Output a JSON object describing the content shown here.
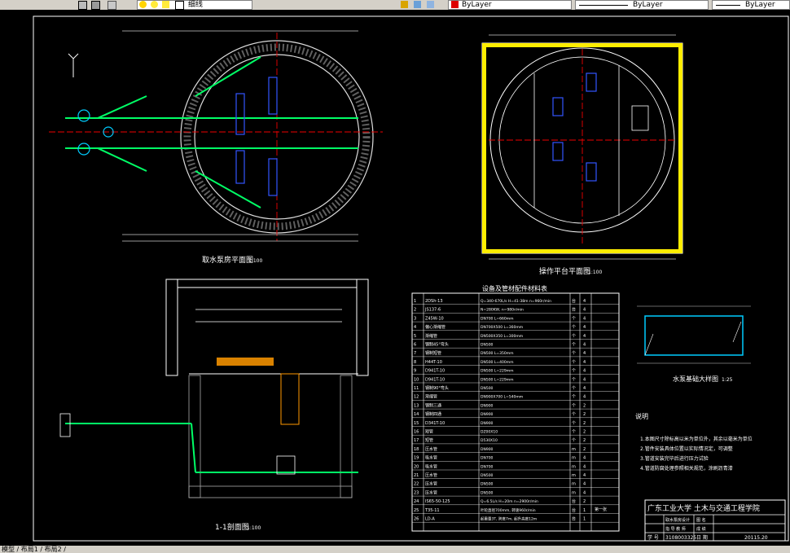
{
  "toolbar": {
    "layer_name": "细线",
    "color_label": "ByLayer",
    "linetype_label": "ByLayer",
    "lineweight_label": "ByLayer"
  },
  "drawing": {
    "plan_title": "取水泵房平面图",
    "plan_scale": "1:100",
    "platform_title": "操作平台平面图",
    "platform_scale": "1:100",
    "section_title": "1-1剖面图",
    "section_scale": "1:100",
    "base_title": "水泵基础大样图",
    "base_scale": "1:25",
    "table_title": "设备及管材配件材料表",
    "notes_title": "说明",
    "notes": [
      "1.本图尺寸除标高以米为单位外，其余以毫米为单位",
      "2.管件安装具体位置以实际情况定，可调整",
      "3.管道安装完毕后进行压力试验",
      "4.管道防腐处理参照相关规范，涂刷沥青漆"
    ],
    "rows": [
      {
        "no": "1",
        "name": "2DSh-13",
        "spec": "Q=340-670L/s H=41-38m n=960r/min",
        "unit": "台",
        "qty": "4"
      },
      {
        "no": "2",
        "name": "JS137-6",
        "spec": "N=280KW, n=980r/min",
        "unit": "台",
        "qty": "4"
      },
      {
        "no": "3",
        "name": "Z45W-10",
        "spec": "DN700 L=660mm",
        "unit": "个",
        "qty": "4"
      },
      {
        "no": "4",
        "name": "偏心渐缩管",
        "spec": "DN700X500 L=360mm",
        "unit": "个",
        "qty": "4"
      },
      {
        "no": "5",
        "name": "渐缩管",
        "spec": "DN500X350 L=300mm",
        "unit": "个",
        "qty": "4"
      },
      {
        "no": "6",
        "name": "钢制45°弯头",
        "spec": "DN500",
        "unit": "个",
        "qty": "4"
      },
      {
        "no": "7",
        "name": "钢制短管",
        "spec": "DN500 L=350mm",
        "unit": "个",
        "qty": "4"
      },
      {
        "no": "8",
        "name": "H44T-10",
        "spec": "DN500 L=400mm",
        "unit": "个",
        "qty": "4"
      },
      {
        "no": "9",
        "name": "D941T-10",
        "spec": "DN500 L=229mm",
        "unit": "个",
        "qty": "4"
      },
      {
        "no": "10",
        "name": "D941T-10",
        "spec": "DN500 L=229mm",
        "unit": "个",
        "qty": "4"
      },
      {
        "no": "11",
        "name": "钢制90°弯头",
        "spec": "DN500",
        "unit": "个",
        "qty": "4"
      },
      {
        "no": "12",
        "name": "渐缩管",
        "spec": "DN900X700 L=540mm",
        "unit": "个",
        "qty": "4"
      },
      {
        "no": "13",
        "name": "钢制三通",
        "spec": "DN900",
        "unit": "个",
        "qty": "2"
      },
      {
        "no": "14",
        "name": "钢制四通",
        "spec": "DN900",
        "unit": "个",
        "qty": "2"
      },
      {
        "no": "15",
        "name": "D341T-10",
        "spec": "DN900",
        "unit": "个",
        "qty": "2"
      },
      {
        "no": "16",
        "name": "短管",
        "spec": "DZ00X10",
        "unit": "个",
        "qty": "2"
      },
      {
        "no": "17",
        "name": "短管",
        "spec": "D530X10",
        "unit": "个",
        "qty": "2"
      },
      {
        "no": "18",
        "name": "压水管",
        "spec": "DN900",
        "unit": "m",
        "qty": "2"
      },
      {
        "no": "19",
        "name": "吸水管",
        "spec": "DN700",
        "unit": "m",
        "qty": "4"
      },
      {
        "no": "20",
        "name": "吸水管",
        "spec": "DN700",
        "unit": "m",
        "qty": "4"
      },
      {
        "no": "21",
        "name": "压水管",
        "spec": "DN500",
        "unit": "m",
        "qty": "4"
      },
      {
        "no": "22",
        "name": "压水管",
        "spec": "DN500",
        "unit": "m",
        "qty": "4"
      },
      {
        "no": "23",
        "name": "压水管",
        "spec": "DN500",
        "unit": "m",
        "qty": "4"
      },
      {
        "no": "24",
        "name": "IS65-50-125",
        "spec": "Q=6.5L/s H=20m n=2900r/min",
        "unit": "台",
        "qty": "2"
      },
      {
        "no": "25",
        "name": "T35-11",
        "spec": "叶轮直径700mm, 转速960r/min",
        "unit": "台",
        "qty": "1"
      },
      {
        "no": "26",
        "name": "LD-A",
        "spec": "起重量3T, 跨度7m, 起升高度12m",
        "unit": "台",
        "qty": "1"
      }
    ],
    "title_block": {
      "school": "广东工业大学  土木与交通工程学院",
      "row1_a": "取水泵房设计",
      "row1_b": "图 名",
      "row2_a": "指 导 教 师",
      "row2_b": "成 绩",
      "student_id_label": "学 号",
      "student_id": "3108003325",
      "date_label": "日 期",
      "date": "20115.20",
      "remark": "第一张"
    }
  },
  "status": {
    "layout_tabs": "模型 / 布局1 / 布局2 /"
  }
}
